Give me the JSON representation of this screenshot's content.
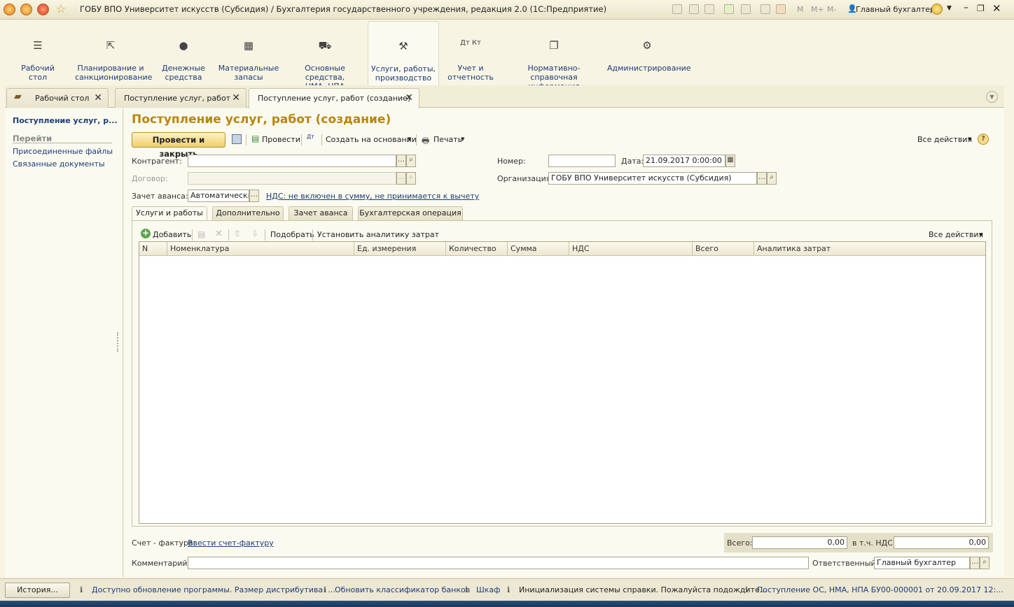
{
  "window": {
    "title": "ГОБУ ВПО Университет искусств (Субсидия) / Бухгалтерия государственного учреждения, редакция 2.0  (1С:Предприятие)",
    "memory_labels": [
      "M",
      "M+",
      "M-"
    ],
    "user": "Главный бухгалтер"
  },
  "sections": [
    {
      "label": "Рабочий\nстол",
      "icon": "menu-icon"
    },
    {
      "label": "Планирование и\nсанкционирование",
      "icon": "planning-icon"
    },
    {
      "label": "Денежные\nсредства",
      "icon": "ruble-icon"
    },
    {
      "label": "Материальные\nзапасы",
      "icon": "grid-icon"
    },
    {
      "label": "Основные средства,\nНМА, НПА",
      "icon": "truck-icon"
    },
    {
      "label": "Услуги, работы,\nпроизводство",
      "icon": "tools-icon"
    },
    {
      "label": "Учет и\nотчетность",
      "icon": "dt-kt-icon"
    },
    {
      "label": "Нормативно-справочная\nинформация",
      "icon": "documents-icon"
    },
    {
      "label": "Администрирование",
      "icon": "gear-icon"
    }
  ],
  "tabs": [
    {
      "label": "Рабочий стол"
    },
    {
      "label": "Поступление услуг, работ"
    },
    {
      "label": "Поступление услуг, работ (создание)"
    }
  ],
  "nav": {
    "current": "Поступление услуг, р...",
    "goto_header": "Перейти",
    "links": [
      "Присоединенные файлы",
      "Связанные документы"
    ]
  },
  "form": {
    "title": "Поступление услуг, работ (создание)",
    "toolbar": {
      "post_and_close": "Провести и закрыть",
      "post": "Провести",
      "create_based_on": "Создать на основании",
      "print": "Печать",
      "all_actions": "Все действия",
      "help": "?"
    },
    "fields": {
      "counterparty_label": "Контрагент:",
      "counterparty_value": "",
      "contract_label": "Договор:",
      "contract_value": "",
      "advance_label": "Зачет аванса:",
      "advance_value": "Автоматически",
      "vat_link": "НДС: не включен в сумму, не принимается к вычету",
      "number_label": "Номер:",
      "number_value": "",
      "date_label": "Дата:",
      "date_value": "21.09.2017  0:00:00",
      "org_label": "Организация:",
      "org_value": "ГОБУ ВПО Университет искусств (Субсидия)"
    },
    "form_tabs": [
      "Услуги и работы",
      "Дополнительно",
      "Зачет аванса",
      "Бухгалтерская операция"
    ],
    "table_toolbar": {
      "add": "Добавить",
      "pick": "Подобрать",
      "set_analytics": "Установить аналитику затрат",
      "all_actions": "Все действия"
    },
    "columns": [
      "N",
      "Номенклатура",
      "Ед. измерения",
      "Количество",
      "Сумма",
      "НДС",
      "Всего",
      "Аналитика затрат"
    ],
    "footer": {
      "invoice_label": "Счет - фактура:",
      "invoice_link": "Ввести счет-фактуру",
      "total_label": "Всего:",
      "total_value": "0,00",
      "vat_label": "в т.ч. НДС:",
      "vat_value": "0,00",
      "comment_label": "Комментарий:",
      "comment_value": "",
      "responsible_label": "Ответственный:",
      "responsible_value": "Главный бухгалтер"
    }
  },
  "statusbar": {
    "history": "История...",
    "items": [
      "Доступно обновление программы. Размер дистрибутива: ...",
      "Обновить классификатор банков",
      "Шкаф",
      "Инициализация системы справки. Пожалуйста подождите...",
      "Поступление ОС, НМА, НПА БУ00-000001 от 20.09.2017 12:..."
    ]
  }
}
